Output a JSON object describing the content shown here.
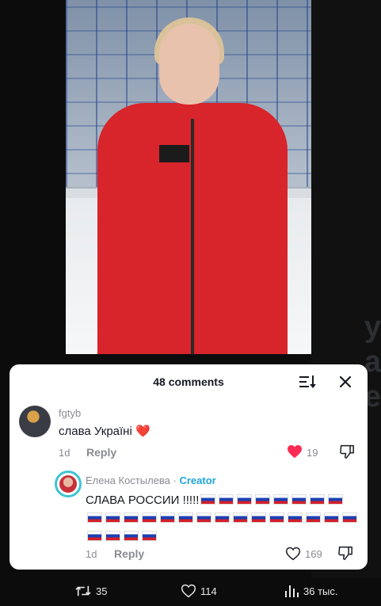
{
  "panel": {
    "title": "48 comments",
    "sort_icon": "sort-icon",
    "close_icon": "close-icon"
  },
  "comments": [
    {
      "username": "fgtyb",
      "text": "слава Україні ❤️",
      "time": "1d",
      "reply_label": "Reply",
      "likes": "19",
      "liked": true
    }
  ],
  "reply": {
    "username": "Елена Костылева",
    "separator": " · ",
    "badge": "Creator",
    "text": "СЛАВА РОССИИ !!!!!",
    "flag_count": 27,
    "time": "1d",
    "reply_label": "Reply",
    "likes": "169",
    "liked": false
  },
  "tweet_actions": {
    "retweets": "35",
    "likes": "114",
    "views": "36 тыс."
  },
  "colors": {
    "like_active": "#fe2c55",
    "creator_badge": "#20a5d8",
    "avatar_ring": "#3fc4d4"
  }
}
